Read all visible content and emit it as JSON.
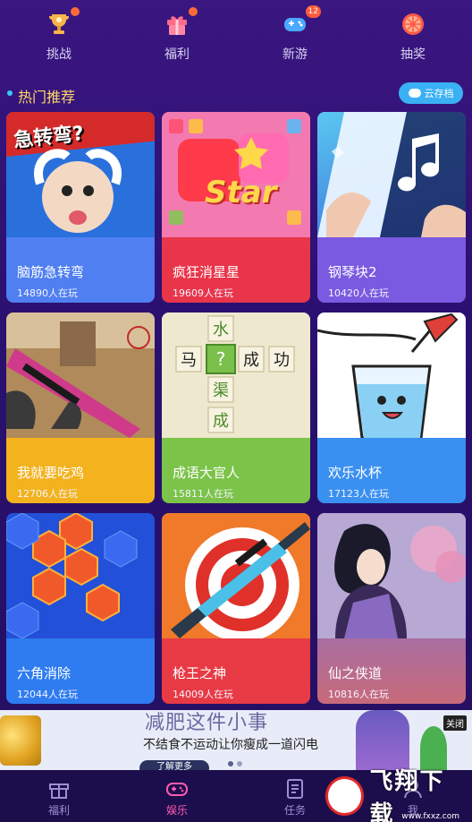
{
  "topnav": {
    "items": [
      {
        "label": "挑战",
        "icon": "trophy-icon",
        "color": "#f7b44a"
      },
      {
        "label": "福利",
        "icon": "gift-icon",
        "color": "#ff6b8a"
      },
      {
        "label": "新游",
        "icon": "gamepad-icon",
        "color": "#4aa8ff",
        "badge": "12"
      },
      {
        "label": "抽奖",
        "icon": "prize-wheel-icon",
        "color": "#ff5a4a"
      }
    ]
  },
  "section": {
    "title": "热门推荐",
    "cloud_label": "云存档"
  },
  "games": [
    {
      "name": "脑筋急转弯",
      "players": "14890人在玩",
      "art_text": "急转弯?",
      "color": "#4f7ff0"
    },
    {
      "name": "疯狂消星星",
      "players": "19609人在玩",
      "art_text": "Star",
      "color": "#e8354a"
    },
    {
      "name": "钢琴块2",
      "players": "10420人在玩",
      "art_text": "",
      "color": "#7a5ae0"
    },
    {
      "name": "我就要吃鸡",
      "players": "12706人在玩",
      "art_text": "",
      "color": "#f3b21e"
    },
    {
      "name": "成语大官人",
      "players": "15811人在玩",
      "art_text": "水 马 ? 成 功 渠 成",
      "color": "#7cc34a"
    },
    {
      "name": "欢乐水杯",
      "players": "17123人在玩",
      "art_text": "",
      "color": "#3a90f0"
    },
    {
      "name": "六角消除",
      "players": "12044人在玩",
      "art_text": "",
      "color": "#2e7cf0"
    },
    {
      "name": "枪王之神",
      "players": "14009人在玩",
      "art_text": "",
      "color": "#e83a44"
    },
    {
      "name": "仙之侠道",
      "players": "10816人在玩",
      "art_text": "",
      "color": "#a86ea0"
    }
  ],
  "ad": {
    "headline": "减肥这件小事",
    "sub": "不结食不运动让你瘦成一道闪电",
    "learn_more": "了解更多",
    "close": "关闭"
  },
  "tabbar": {
    "items": [
      {
        "label": "福利",
        "icon": "gift-box-icon",
        "active": false
      },
      {
        "label": "娱乐",
        "icon": "gamepad-icon",
        "active": true
      },
      {
        "label": "任务",
        "icon": "task-list-icon",
        "active": false
      },
      {
        "label": "我",
        "icon": "user-icon",
        "active": false
      }
    ]
  },
  "watermark": {
    "brand": "飞翔下载",
    "site": "www.fxxz.com"
  }
}
